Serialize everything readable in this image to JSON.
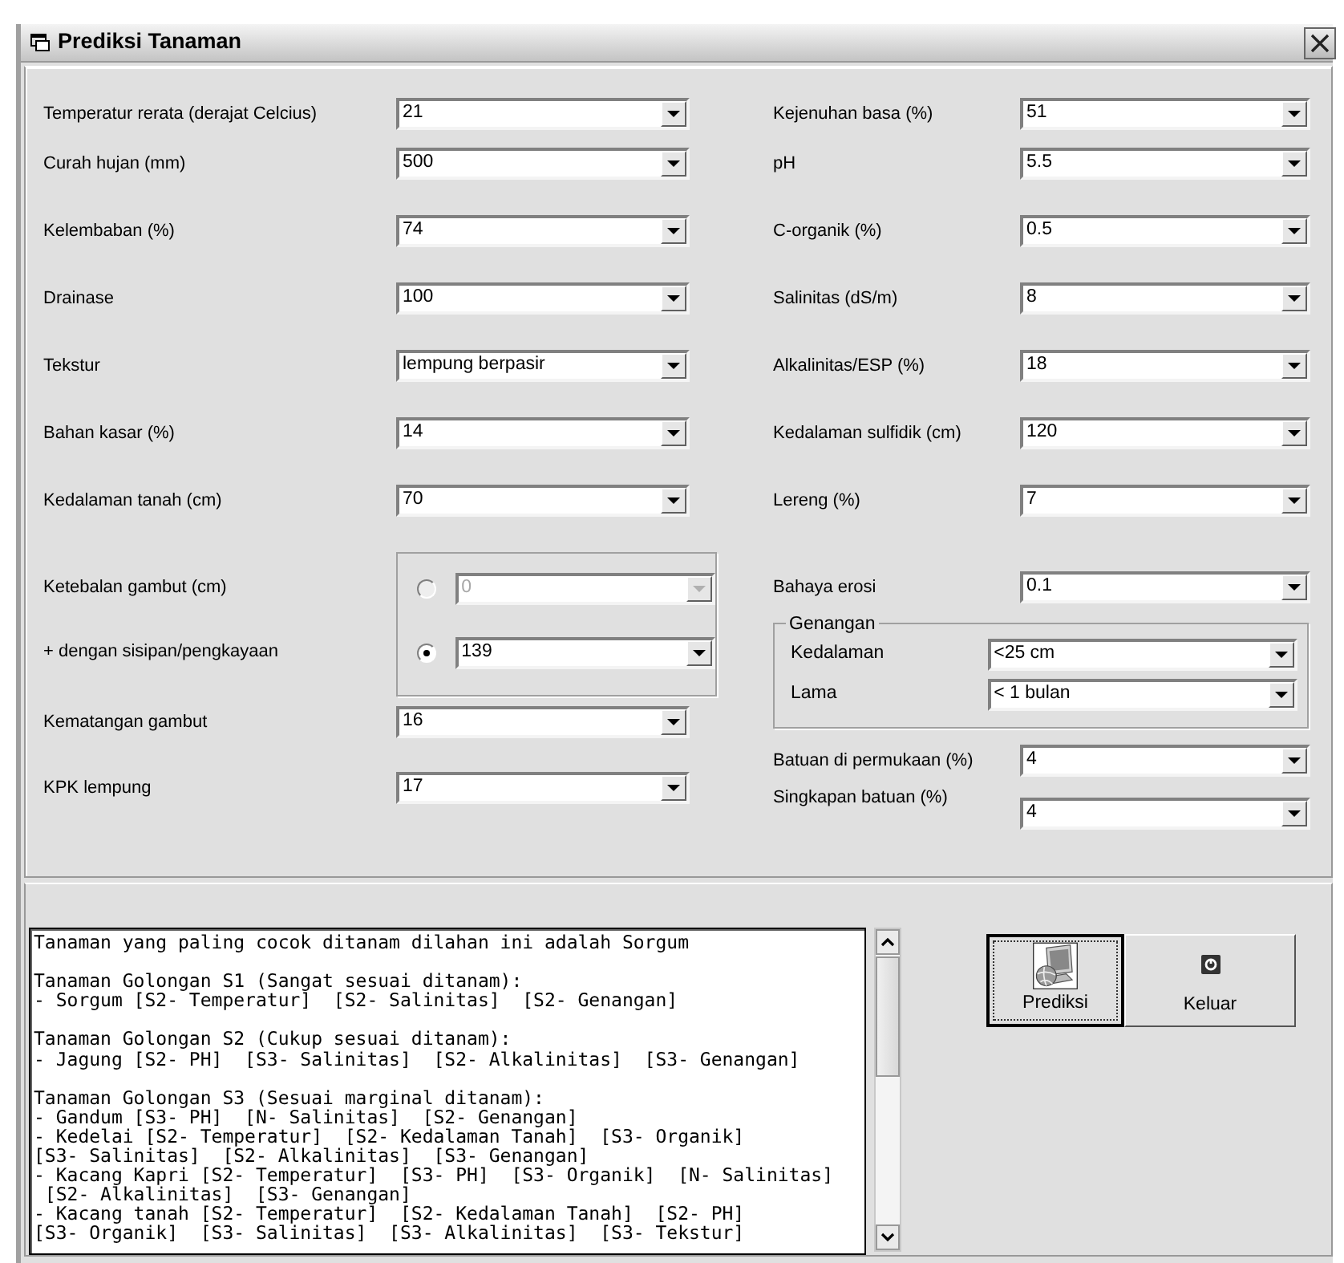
{
  "window": {
    "title": "Prediksi Tanaman"
  },
  "left_fields": [
    {
      "label": "Temperatur  rerata (derajat Celcius)",
      "value": "21"
    },
    {
      "label": "Curah hujan (mm)",
      "value": "500"
    },
    {
      "label": "Kelembaban (%)",
      "value": "74"
    },
    {
      "label": "Drainase",
      "value": "100"
    },
    {
      "label": "Tekstur",
      "value": "lempung berpasir"
    },
    {
      "label": "Bahan kasar  (%)",
      "value": "14"
    },
    {
      "label": "Kedalaman tanah (cm)",
      "value": "70"
    }
  ],
  "peat_options": [
    {
      "label": "Ketebalan gambut (cm)",
      "value": "0",
      "checked": false,
      "disabled": true
    },
    {
      "label": "+ dengan sisipan/pengkayaan",
      "value": "139",
      "checked": true,
      "disabled": false
    }
  ],
  "left_fields_2": [
    {
      "label": "Kematangan gambut",
      "value": "16"
    },
    {
      "label": "KPK lempung",
      "value": "17"
    }
  ],
  "right_fields": [
    {
      "label": "Kejenuhan basa (%)",
      "value": "51"
    },
    {
      "label": "pH",
      "value": "5.5"
    },
    {
      "label": "C-organik (%)",
      "value": "0.5"
    },
    {
      "label": "Salinitas (dS/m)",
      "value": "8"
    },
    {
      "label": "Alkalinitas/ESP (%)",
      "value": "18"
    },
    {
      "label": "Kedalaman sulfidik (cm)",
      "value": "120"
    },
    {
      "label": "Lereng (%)",
      "value": "7"
    },
    {
      "label": "Bahaya erosi",
      "value": "0.1"
    }
  ],
  "genangan": {
    "title": "Genangan",
    "fields": [
      {
        "label": "Kedalaman",
        "value": "<25 cm"
      },
      {
        "label": "Lama",
        "value": "< 1 bulan"
      }
    ]
  },
  "right_fields_2": [
    {
      "label": "Batuan di permukaan (%)",
      "value": "4"
    },
    {
      "label": "Singkapan batuan (%)",
      "value": "4"
    }
  ],
  "result_paragraphs": [
    [
      "Tanaman yang paling cocok ditanam dilahan ini adalah Sorgum"
    ],
    [
      "Tanaman Golongan S1 (Sangat sesuai ditanam):",
      "- Sorgum [S2- Temperatur]  [S2- Salinitas]  [S2- Genangan]"
    ],
    [
      "Tanaman Golongan S2 (Cukup sesuai ditanam):",
      "- Jagung [S2- PH]  [S3- Salinitas]  [S2- Alkalinitas]  [S3- Genangan]"
    ],
    [
      "Tanaman Golongan S3 (Sesuai marginal ditanam):",
      "- Gandum [S3- PH]  [N- Salinitas]  [S2- Genangan]",
      "- Kedelai [S2- Temperatur]  [S2- Kedalaman Tanah]  [S3- Organik]",
      "[S3- Salinitas]  [S2- Alkalinitas]  [S3- Genangan]",
      "- Kacang Kapri [S2- Temperatur]  [S3- PH]  [S3- Organik]  [N- Salinitas]",
      " [S2- Alkalinitas]  [S3- Genangan]",
      "- Kacang tanah [S2- Temperatur]  [S2- Kedalaman Tanah]  [S2- PH]",
      "[S3- Organik]  [S3- Salinitas]  [S3- Alkalinitas]  [S3- Tekstur]"
    ]
  ],
  "buttons": [
    {
      "label": "Prediksi",
      "kind": "predict",
      "focused": true
    },
    {
      "label": "Keluar",
      "kind": "exit",
      "focused": false
    }
  ]
}
